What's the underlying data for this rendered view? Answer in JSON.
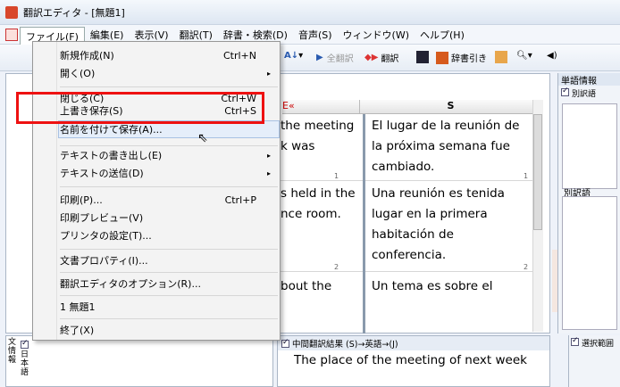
{
  "window": {
    "title": "翻訳エディタ - [無題1]"
  },
  "menubar": [
    "ファイル(F)",
    "編集(E)",
    "表示(V)",
    "翻訳(T)",
    "辞書・検索(D)",
    "音声(S)",
    "ウィンドウ(W)",
    "ヘルプ(H)"
  ],
  "toolbar": {
    "all_translate": "全翻訳",
    "translate": "翻訳",
    "dictionary": "辞書引き"
  },
  "file_menu": [
    {
      "label": "新規作成(N)",
      "shortcut": "Ctrl+N"
    },
    {
      "label": "開く(O)",
      "arrow": "▸"
    },
    {
      "label": "閉じる(C)",
      "shortcut": "Ctrl+W"
    },
    {
      "label": "上書き保存(S)",
      "shortcut": "Ctrl+S"
    },
    {
      "label": "名前を付けて保存(A)..."
    },
    {
      "label": "テキストの書き出し(E)",
      "arrow": "▸"
    },
    {
      "label": "テキストの送信(D)",
      "arrow": "▸"
    },
    {
      "label": "印刷(P)...",
      "shortcut": "Ctrl+P"
    },
    {
      "label": "印刷プレビュー(V)"
    },
    {
      "label": "プリンタの設定(T)..."
    },
    {
      "label": "文書プロパティ(I)..."
    },
    {
      "label": "翻訳エディタのオプション(R)..."
    },
    {
      "label": "1 無題1"
    },
    {
      "label": "終了(X)"
    }
  ],
  "editor": {
    "column_left": "E«",
    "column_right": "S",
    "rows": [
      {
        "num": "1",
        "left": [
          "the meeting",
          "k was",
          ""
        ],
        "right": [
          "El lugar de la reunión de",
          "la próxima semana fue",
          "cambiado."
        ]
      },
      {
        "num": "2",
        "left": [
          "s held in the",
          "nce room.",
          "",
          ""
        ],
        "right": [
          "Una reunión es tenida",
          "lugar en la primera",
          "habitación de",
          "conferencia."
        ]
      },
      {
        "num": "",
        "left": [
          "bout the"
        ],
        "right": [
          "Un tema es sobre el"
        ]
      }
    ]
  },
  "right_panel": {
    "title": "単語情報",
    "check": "別訳語",
    "label": "別訳語"
  },
  "bottom_middle": {
    "header": "中間翻訳結果 (S)→英語→(J)",
    "text": "The place of the meeting of next week"
  },
  "bottom_left": {
    "label": "文情報",
    "sub": "日本語"
  },
  "bottom_right": {
    "check": "選択範囲"
  }
}
